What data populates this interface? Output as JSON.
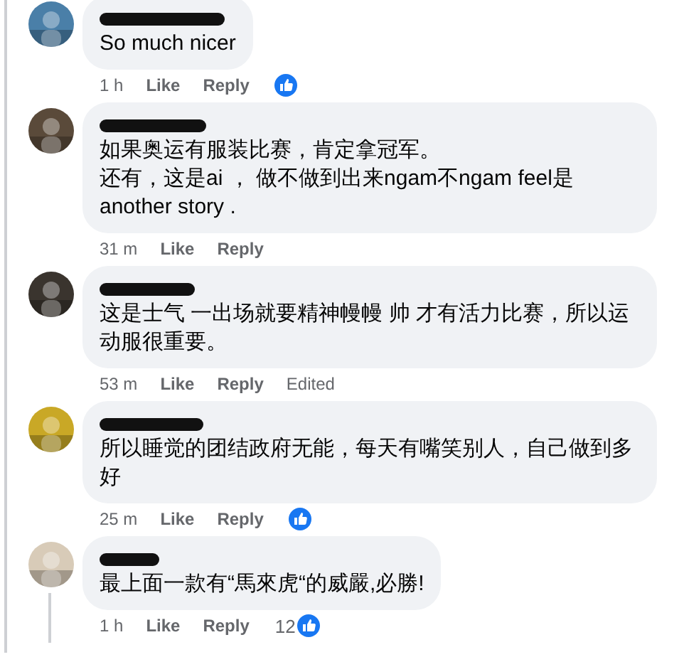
{
  "comments": [
    {
      "lines": [
        "So much nicer"
      ],
      "time": "1 h",
      "like": "Like",
      "reply": "Reply",
      "liked": true,
      "thread": false
    },
    {
      "lines": [
        "如果奥运有服装比赛，肯定拿冠军。",
        "还有，这是ai ， 做不做到出来ngam不ngam feel是 another story ."
      ],
      "time": "31 m",
      "like": "Like",
      "reply": "Reply",
      "liked": false,
      "thread": false
    },
    {
      "lines": [
        "这是士气 一出场就要精神幔幔 帅 才有活力比赛，所以运动服很重要。"
      ],
      "time": "53 m",
      "like": "Like",
      "reply": "Reply",
      "edited": "Edited",
      "liked": false,
      "thread": false
    },
    {
      "lines": [
        "所以睡觉的团结政府无能，每天有嘴笑别人，自己做到多好"
      ],
      "time": "25 m",
      "like": "Like",
      "reply": "Reply",
      "liked": true,
      "thread": false
    },
    {
      "lines": [
        "最上面一款有“馬來虎“的威嚴,必勝!"
      ],
      "time": "1 h",
      "like": "Like",
      "reply": "Reply",
      "liked": true,
      "count": "12",
      "thread": true
    }
  ]
}
